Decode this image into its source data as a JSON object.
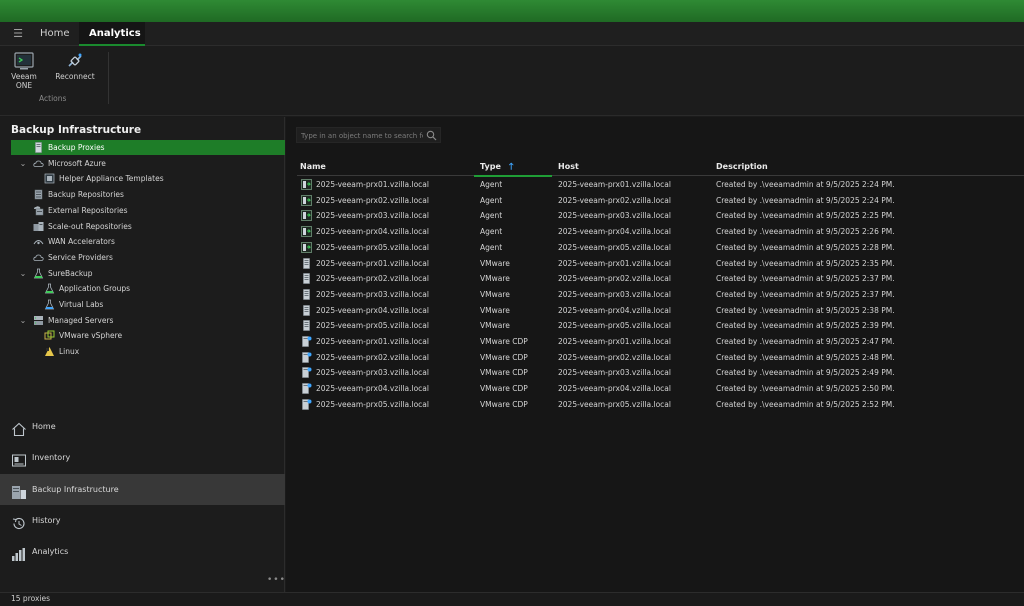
{
  "tabs": {
    "home": "Home",
    "analytics": "Analytics"
  },
  "ribbon": {
    "veeam_one_label": "Veeam ONE",
    "reconnect_label": "Reconnect",
    "group_label": "Actions"
  },
  "left": {
    "title": "Backup Infrastructure",
    "tree": [
      {
        "label": "Backup Proxies",
        "icon": "server-icon",
        "level": 1,
        "chevron": "",
        "selected": true
      },
      {
        "label": "Microsoft Azure",
        "icon": "cloud-icon",
        "level": 1,
        "chevron": "expanded",
        "selected": false
      },
      {
        "label": "Helper Appliance Templates",
        "icon": "template-icon",
        "level": 2,
        "chevron": "",
        "selected": false
      },
      {
        "label": "Backup Repositories",
        "icon": "repository-icon",
        "level": 1,
        "chevron": "",
        "selected": false
      },
      {
        "label": "External Repositories",
        "icon": "external-repository-icon",
        "level": 1,
        "chevron": "",
        "selected": false
      },
      {
        "label": "Scale-out Repositories",
        "icon": "scaleout-repository-icon",
        "level": 1,
        "chevron": "",
        "selected": false
      },
      {
        "label": "WAN Accelerators",
        "icon": "wan-accelerator-icon",
        "level": 1,
        "chevron": "",
        "selected": false
      },
      {
        "label": "Service Providers",
        "icon": "cloud-icon",
        "level": 1,
        "chevron": "",
        "selected": false
      },
      {
        "label": "SureBackup",
        "icon": "flask-icon",
        "level": 1,
        "chevron": "expanded",
        "selected": false
      },
      {
        "label": "Application Groups",
        "icon": "application-group-icon",
        "level": 2,
        "chevron": "",
        "selected": false
      },
      {
        "label": "Virtual Labs",
        "icon": "virtual-lab-icon",
        "level": 2,
        "chevron": "",
        "selected": false
      },
      {
        "label": "Managed Servers",
        "icon": "servers-icon",
        "level": 1,
        "chevron": "expanded",
        "selected": false
      },
      {
        "label": "VMware vSphere",
        "icon": "vsphere-icon",
        "level": 2,
        "chevron": "",
        "selected": false
      },
      {
        "label": "Linux",
        "icon": "linux-icon",
        "level": 2,
        "chevron": "",
        "selected": false
      }
    ],
    "nav": [
      {
        "label": "Home",
        "icon": "home-icon",
        "active": false
      },
      {
        "label": "Inventory",
        "icon": "inventory-icon",
        "active": false
      },
      {
        "label": "Backup Infrastructure",
        "icon": "backup-infrastructure-icon",
        "active": true
      },
      {
        "label": "History",
        "icon": "history-icon",
        "active": false
      },
      {
        "label": "Analytics",
        "icon": "analytics-icon",
        "active": false
      }
    ],
    "more_label": "•••"
  },
  "search": {
    "placeholder": "Type in an object name to search for"
  },
  "grid": {
    "columns": {
      "name": "Name",
      "type": "Type",
      "host": "Host",
      "description": "Description"
    },
    "sort_arrow": "🡑",
    "rows": [
      {
        "name": "2025-veeam-prx01.vzilla.local",
        "type": "Agent",
        "host": "2025-veeam-prx01.vzilla.local",
        "description": "Created by .\\veeamadmin at 9/5/2025 2:24 PM.",
        "icon": "agent-proxy-icon"
      },
      {
        "name": "2025-veeam-prx02.vzilla.local",
        "type": "Agent",
        "host": "2025-veeam-prx02.vzilla.local",
        "description": "Created by .\\veeamadmin at 9/5/2025 2:24 PM.",
        "icon": "agent-proxy-icon"
      },
      {
        "name": "2025-veeam-prx03.vzilla.local",
        "type": "Agent",
        "host": "2025-veeam-prx03.vzilla.local",
        "description": "Created by .\\veeamadmin at 9/5/2025 2:25 PM.",
        "icon": "agent-proxy-icon"
      },
      {
        "name": "2025-veeam-prx04.vzilla.local",
        "type": "Agent",
        "host": "2025-veeam-prx04.vzilla.local",
        "description": "Created by .\\veeamadmin at 9/5/2025 2:26 PM.",
        "icon": "agent-proxy-icon"
      },
      {
        "name": "2025-veeam-prx05.vzilla.local",
        "type": "Agent",
        "host": "2025-veeam-prx05.vzilla.local",
        "description": "Created by .\\veeamadmin at 9/5/2025 2:28 PM.",
        "icon": "agent-proxy-icon"
      },
      {
        "name": "2025-veeam-prx01.vzilla.local",
        "type": "VMware",
        "host": "2025-veeam-prx01.vzilla.local",
        "description": "Created by .\\veeamadmin at 9/5/2025 2:35 PM.",
        "icon": "vmware-proxy-icon"
      },
      {
        "name": "2025-veeam-prx02.vzilla.local",
        "type": "VMware",
        "host": "2025-veeam-prx02.vzilla.local",
        "description": "Created by .\\veeamadmin at 9/5/2025 2:37 PM.",
        "icon": "vmware-proxy-icon"
      },
      {
        "name": "2025-veeam-prx03.vzilla.local",
        "type": "VMware",
        "host": "2025-veeam-prx03.vzilla.local",
        "description": "Created by .\\veeamadmin at 9/5/2025 2:37 PM.",
        "icon": "vmware-proxy-icon"
      },
      {
        "name": "2025-veeam-prx04.vzilla.local",
        "type": "VMware",
        "host": "2025-veeam-prx04.vzilla.local",
        "description": "Created by .\\veeamadmin at 9/5/2025 2:38 PM.",
        "icon": "vmware-proxy-icon"
      },
      {
        "name": "2025-veeam-prx05.vzilla.local",
        "type": "VMware",
        "host": "2025-veeam-prx05.vzilla.local",
        "description": "Created by .\\veeamadmin at 9/5/2025 2:39 PM.",
        "icon": "vmware-proxy-icon"
      },
      {
        "name": "2025-veeam-prx01.vzilla.local",
        "type": "VMware CDP",
        "host": "2025-veeam-prx01.vzilla.local",
        "description": "Created by .\\veeamadmin at 9/5/2025 2:47 PM.",
        "icon": "cdp-proxy-icon"
      },
      {
        "name": "2025-veeam-prx02.vzilla.local",
        "type": "VMware CDP",
        "host": "2025-veeam-prx02.vzilla.local",
        "description": "Created by .\\veeamadmin at 9/5/2025 2:48 PM.",
        "icon": "cdp-proxy-icon"
      },
      {
        "name": "2025-veeam-prx03.vzilla.local",
        "type": "VMware CDP",
        "host": "2025-veeam-prx03.vzilla.local",
        "description": "Created by .\\veeamadmin at 9/5/2025 2:49 PM.",
        "icon": "cdp-proxy-icon"
      },
      {
        "name": "2025-veeam-prx04.vzilla.local",
        "type": "VMware CDP",
        "host": "2025-veeam-prx04.vzilla.local",
        "description": "Created by .\\veeamadmin at 9/5/2025 2:50 PM.",
        "icon": "cdp-proxy-icon"
      },
      {
        "name": "2025-veeam-prx05.vzilla.local",
        "type": "VMware CDP",
        "host": "2025-veeam-prx05.vzilla.local",
        "description": "Created by .\\veeamadmin at 9/5/2025 2:52 PM.",
        "icon": "cdp-proxy-icon"
      }
    ]
  },
  "status": {
    "text": "15 proxies"
  },
  "colors": {
    "accent_green": "#1e7d28",
    "header_green": "#2e7d32",
    "sort_blue": "#3ea6ff"
  }
}
